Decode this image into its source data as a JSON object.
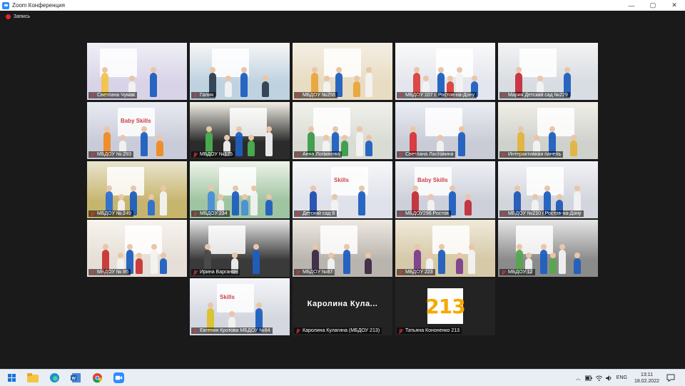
{
  "window": {
    "title": "Zoom Конференция",
    "controls": {
      "minimize": "—",
      "maximize": "▢",
      "close": "✕"
    }
  },
  "recording": {
    "label": "Запись"
  },
  "tiles": [
    {
      "name": "Светлана Чумак",
      "active": true
    },
    {
      "name": "Галия"
    },
    {
      "name": "МБДОУ №256"
    },
    {
      "name": "МБДОУ 107 г. Ростов-на-Дону"
    },
    {
      "name": "Мария Детский сад №229"
    },
    {
      "name": "МБДОУ № 293",
      "banner": "Baby Skills"
    },
    {
      "name": "МБДОУ №175"
    },
    {
      "name": "Анна Логвинова"
    },
    {
      "name": "Светлана Ластовина"
    },
    {
      "name": "Интерактивная панель"
    },
    {
      "name": "МБДОУ № 249"
    },
    {
      "name": "МБДОУ 234"
    },
    {
      "name": "Детский сад 8",
      "banner": "Skills"
    },
    {
      "name": "МБДОУ296 Ростов",
      "banner": "Baby Skills"
    },
    {
      "name": "МБДОУ №210 г.Ростов-на-Дону"
    },
    {
      "name": "МБДОУ № 86"
    },
    {
      "name": "Ирина Варганян"
    },
    {
      "name": "МБДОУ №87"
    },
    {
      "name": "МБДОУ 223"
    },
    {
      "name": "МБДОУ 12"
    },
    {
      "name": "Евгения Кротова МБДОУ №84",
      "banner": "Skills"
    },
    {
      "name": "Каролина Кулагина (МБДОУ 213)",
      "center_name": "Каролина  Кула..."
    },
    {
      "name": "Татьяна Кононенко 213",
      "badge": "213"
    }
  ],
  "taskbar": {
    "icons": [
      "windows-start-icon",
      "file-explorer-icon",
      "edge-icon",
      "word-icon",
      "chrome-icon",
      "zoom-icon"
    ],
    "tray": {
      "language": "ENG",
      "time": "13:11",
      "date": "18.02.2022"
    }
  },
  "colors": {
    "active_border": "#b8d84a",
    "recording": "#e0262c",
    "muted_mic": "#e3343a",
    "badge_number": "#f4a900"
  }
}
